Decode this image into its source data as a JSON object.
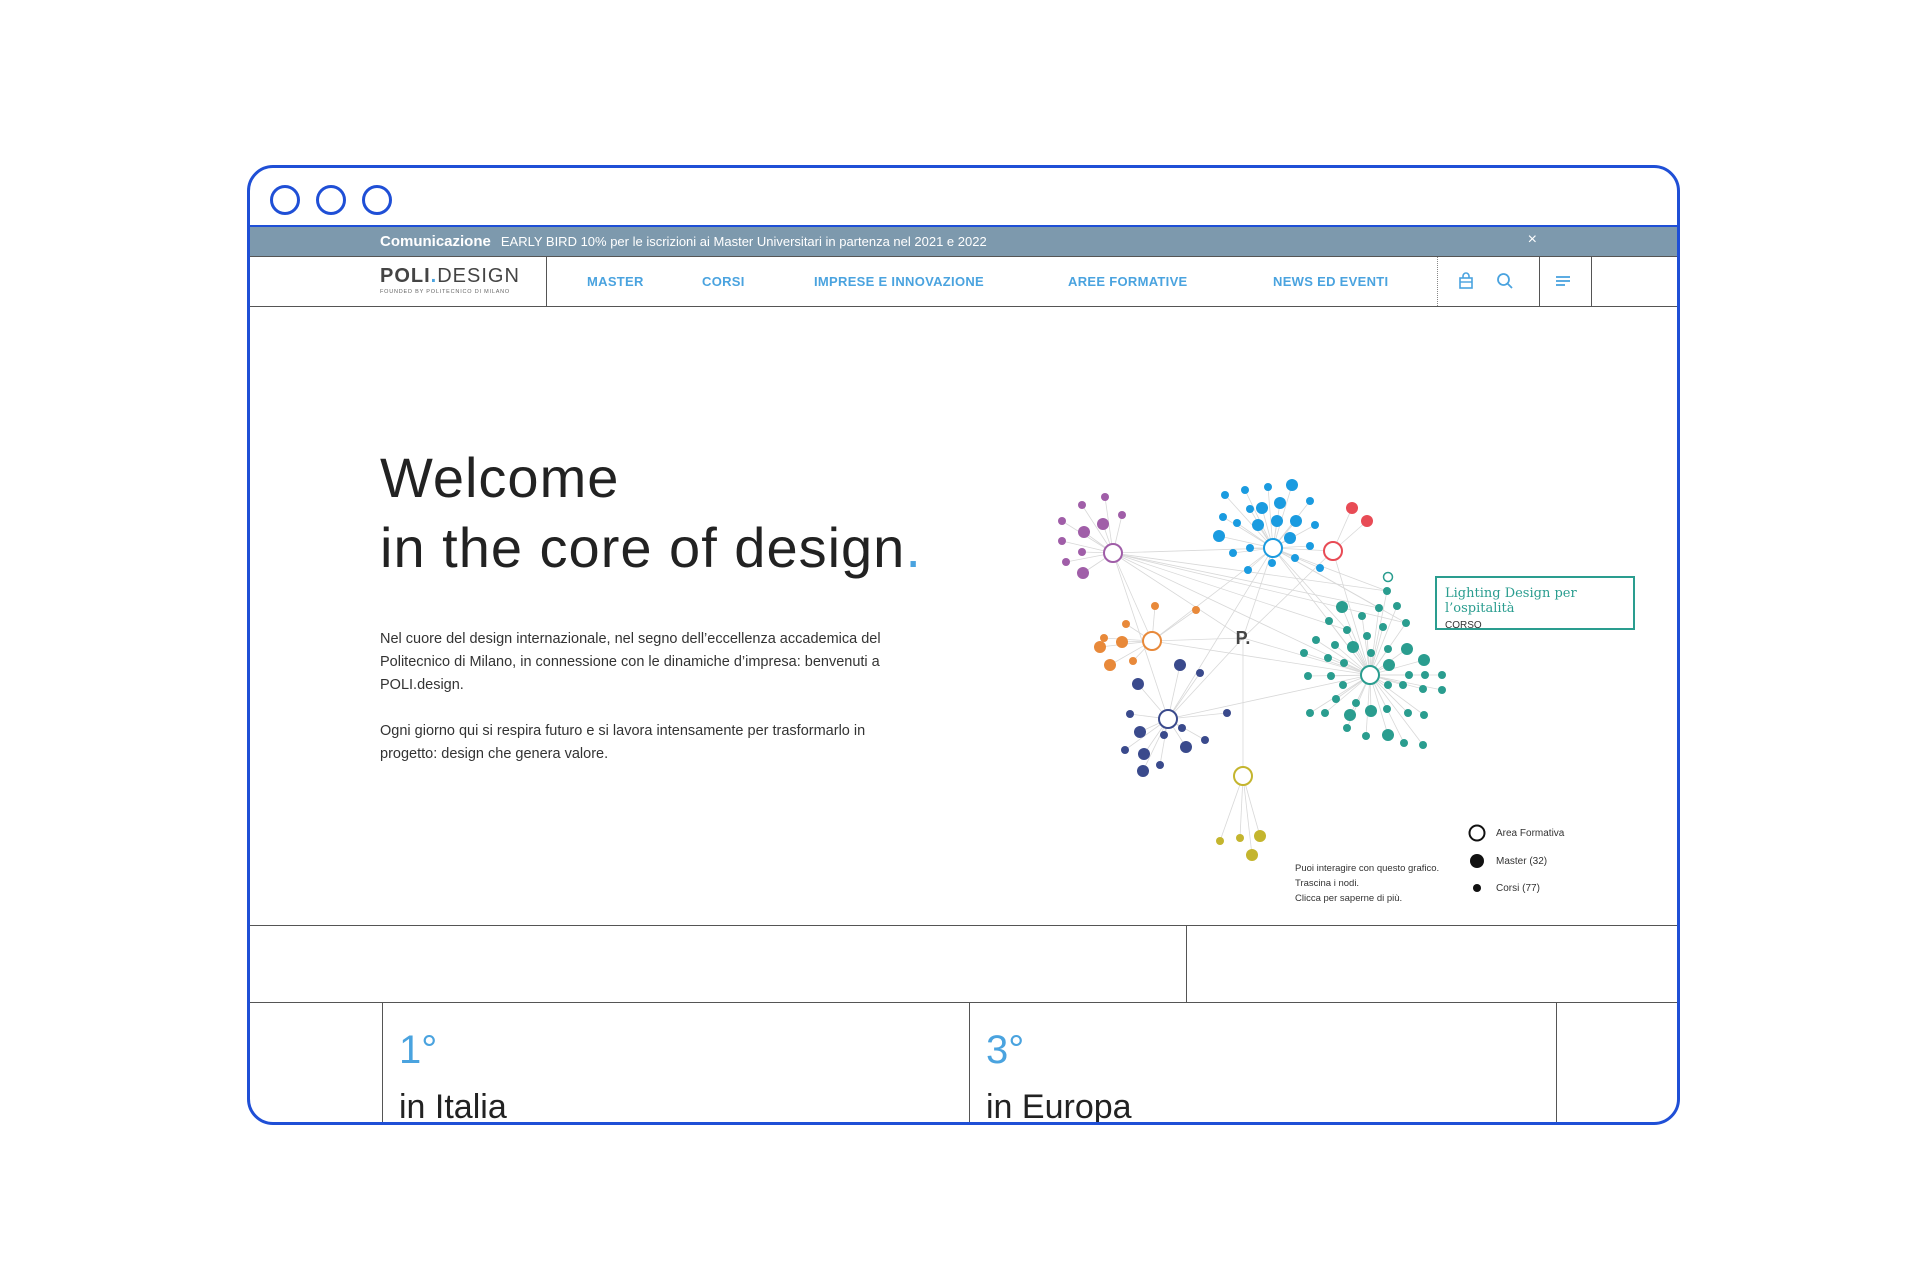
{
  "window": {
    "controls": [
      "circle",
      "circle",
      "circle"
    ]
  },
  "notice": {
    "label": "Comunicazione",
    "text": "EARLY BIRD 10% per le iscrizioni ai Master Universitari in partenza nel 2021 e 2022",
    "close": "×"
  },
  "logo": {
    "main_bold": "POLI",
    "main_dot": ".",
    "main_light": "DESIGN",
    "sub": "FOUNDED BY POLITECNICO DI MILANO"
  },
  "nav": {
    "items": [
      {
        "label": "MASTER"
      },
      {
        "label": "CORSI"
      },
      {
        "label": "IMPRESE E INNOVAZIONE"
      },
      {
        "label": "AREE FORMATIVE"
      },
      {
        "label": "NEWS ED EVENTI"
      }
    ],
    "icons": [
      "bag-icon",
      "search-icon",
      "menu-icon"
    ]
  },
  "hero": {
    "title_line1": "Welcome",
    "title_line2": "in the core of design",
    "title_dot": ".",
    "p1": "Nel cuore del design internazionale, nel segno dell’eccellenza accademica del Politecnico di Milano, in connessione con le dinamiche d’impresa: benvenuti a POLI.design.",
    "p2": "Ogni giorno qui si respira futuro e si lavora intensamente per trasformarlo in progetto: design che genera valore."
  },
  "graph": {
    "center_label": "P.",
    "colors": {
      "purple": "#a05ea8",
      "blue": "#1a9be0",
      "red": "#e84b55",
      "orange": "#e8893a",
      "navy": "#3a4a8c",
      "teal": "#2a9d8f",
      "olive": "#c4b52e",
      "edge": "#d8d8d8"
    },
    "tooltip": {
      "title": "Lighting Design per l’ospitalità",
      "type": "CORSO"
    },
    "hint": [
      "Puoi interagire con questo grafico.",
      "Trascina i nodi.",
      "Clicca per saperne di più."
    ],
    "legend": [
      {
        "label": "Area Formativa"
      },
      {
        "label": "Master (32)"
      },
      {
        "label": "Corsi (77)"
      }
    ]
  },
  "stats": [
    {
      "num": "1°",
      "label": "in Italia"
    },
    {
      "num": "3°",
      "label": "in Europa"
    }
  ]
}
